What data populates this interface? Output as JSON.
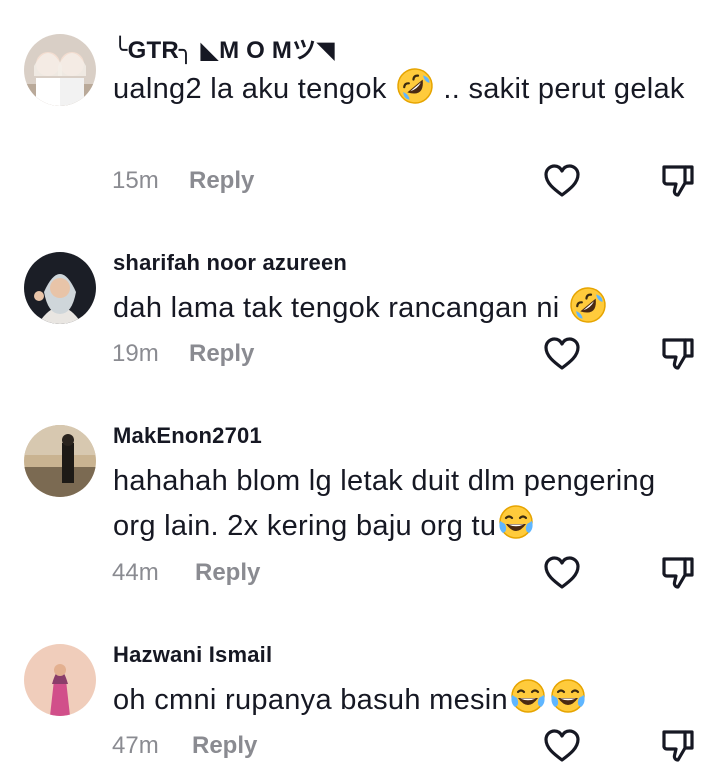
{
  "comments": [
    {
      "username": "╰GTR╮ ◣M O Mツ◥",
      "text_parts": [
        "ualng2 la aku tengok",
        ".. sakit perut gelak"
      ],
      "emoji": "rolling-on-floor-laughing",
      "time": "15m",
      "reply_label": "Reply"
    },
    {
      "username": "sharifah noor azureen",
      "text_parts": [
        "dah lama tak tengok rancangan ni"
      ],
      "emoji": "rolling-on-floor-laughing",
      "time": "19m",
      "reply_label": "Reply"
    },
    {
      "username": "MakEnon2701",
      "text_parts": [
        "hahahah blom lg letak duit dlm pengering org lain. 2x kering baju org tu"
      ],
      "emoji": "face-with-tears-of-joy",
      "time": "44m",
      "reply_label": "Reply"
    },
    {
      "username": "Hazwani Ismail",
      "text_parts": [
        "oh cmni rupanya basuh mesin"
      ],
      "emoji": "face-with-tears-of-joy",
      "time": "47m",
      "reply_label": "Reply"
    }
  ],
  "colors": {
    "text": "#161823",
    "muted": "#8a8b91",
    "icon": "#161823"
  },
  "icons": {
    "like": "heart-outline-icon",
    "dislike": "thumbs-down-outline-icon"
  }
}
